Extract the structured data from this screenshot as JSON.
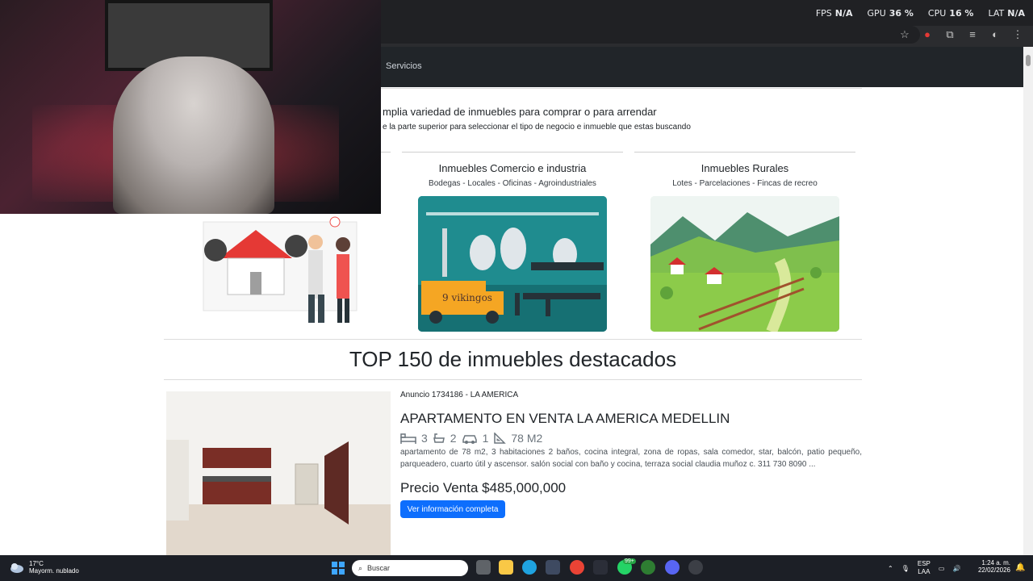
{
  "overlay": {
    "fps_label": "FPS",
    "fps_value": "N/A",
    "gpu_label": "GPU",
    "gpu_value": "36 %",
    "cpu_label": "CPU",
    "cpu_value": "16 %",
    "lat_label": "LAT",
    "lat_value": "N/A"
  },
  "nav": {
    "servicios": "Servicios"
  },
  "intro": {
    "line1": "mplia variedad de inmuebles para comprar o para arrendar",
    "line2": "e la parte superior para seleccionar el tipo de negocio e inmueble que estas buscando"
  },
  "categories": [
    {
      "title": "Inmuebles Comercio e industria",
      "subtitle": "Bodegas - Locales - Oficinas - Agroindustriales"
    },
    {
      "title": "Inmuebles Rurales",
      "subtitle": "Lotes - Parcelaciones - Fincas de recreo"
    }
  ],
  "industry_truck_text": "9 vikingos",
  "section_title": "TOP 150 de inmuebles destacados",
  "listing": {
    "meta": "Anuncio 1734186 - LA AMERICA",
    "title": "APARTAMENTO EN VENTA LA AMERICA MEDELLIN",
    "bedrooms": "3",
    "bathrooms": "2",
    "parking": "1",
    "area": "78 M2",
    "description": "apartamento de 78 m2, 3 habitaciones 2 baños, cocina integral, zona de ropas, sala comedor, star, balcón, patio pequeño, parqueadero, cuarto útil y ascensor. salón social con baño y cocina, terraza social claudia muñoz c. 311 730 8090 ...",
    "price": "Precio Venta $485,000,000",
    "button": "Ver información completa"
  },
  "taskbar": {
    "temperature": "17°C",
    "condition": "Mayorm. nublado",
    "search_placeholder": "Buscar",
    "lang_top": "ESP",
    "lang_bottom": "LAA",
    "time": "1:24 a. m.",
    "date": "22/02/2026",
    "whatsapp_badge": "99+"
  },
  "colors": {
    "navbar": "#212529",
    "button": "#0d6efd",
    "browser_chrome": "#202124",
    "taskbar": "#1c1f26"
  }
}
